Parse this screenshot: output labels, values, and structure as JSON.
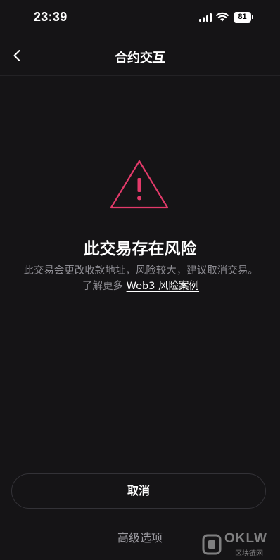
{
  "status_bar": {
    "time": "23:39",
    "battery": "81"
  },
  "nav": {
    "title": "合约交互"
  },
  "warning": {
    "title": "此交易存在风险",
    "desc_text": "此交易会更改收款地址，风险较大，建议取消交易。了解更多 ",
    "link_text": "Web3 风险案例",
    "accent_color": "#e33a6a"
  },
  "actions": {
    "cancel_label": "取消",
    "advanced_label": "高级选项"
  },
  "watermark": {
    "brand": "OKLW",
    "sub": "区块链网"
  }
}
